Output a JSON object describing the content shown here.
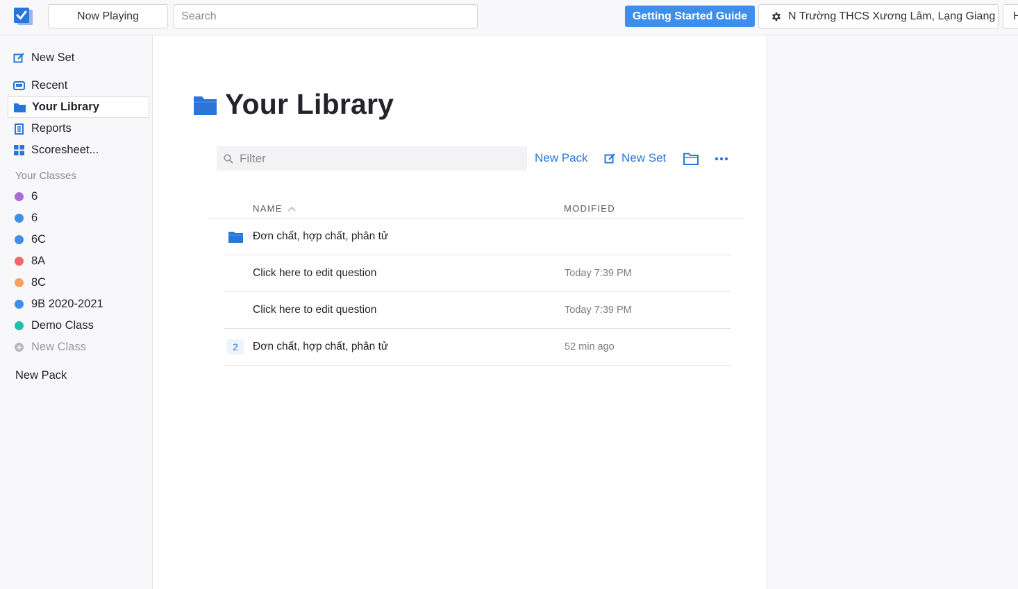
{
  "topbar": {
    "now_playing": "Now Playing",
    "search_placeholder": "Search",
    "guide": "Getting Started Guide",
    "school": "N Trường THCS Xương Lâm, Lạng Giang",
    "help": "H"
  },
  "sidebar": {
    "new_set": "New Set",
    "items": [
      {
        "label": "Recent",
        "icon": "recent-icon"
      },
      {
        "label": "Your Library",
        "icon": "folder-icon"
      },
      {
        "label": "Reports",
        "icon": "reports-icon"
      },
      {
        "label": "Scoresheet...",
        "icon": "scoresheet-icon"
      }
    ],
    "classes_heading": "Your Classes",
    "classes": [
      {
        "label": "6",
        "color": "#a86ed8"
      },
      {
        "label": "6",
        "color": "#3f8fea"
      },
      {
        "label": "6C",
        "color": "#3f8fea"
      },
      {
        "label": "8A",
        "color": "#ee6a6a"
      },
      {
        "label": "8C",
        "color": "#f5a160"
      },
      {
        "label": "9B 2020-2021",
        "color": "#3f8fea"
      },
      {
        "label": "Demo Class",
        "color": "#1fbfb0"
      }
    ],
    "new_class": "New Class",
    "new_pack": "New Pack"
  },
  "main": {
    "title": "Your Library",
    "filter_placeholder": "Filter",
    "new_pack": "New Pack",
    "new_set": "New Set",
    "columns": {
      "name": "NAME",
      "modified": "MODIFIED"
    },
    "rows": [
      {
        "type": "folder",
        "name": "Đơn chất, hợp chất, phân tử",
        "modified": ""
      },
      {
        "type": "set",
        "name": "Click here to edit question",
        "modified": "Today 7:39 PM"
      },
      {
        "type": "set",
        "name": "Click here to edit question",
        "modified": "Today 7:39 PM"
      },
      {
        "type": "count",
        "count": "2",
        "name": "Đơn chất, hợp chất, phân tử",
        "modified": "52 min ago"
      }
    ]
  },
  "colors": {
    "accent": "#3f8fea",
    "link": "#2a75d8"
  }
}
